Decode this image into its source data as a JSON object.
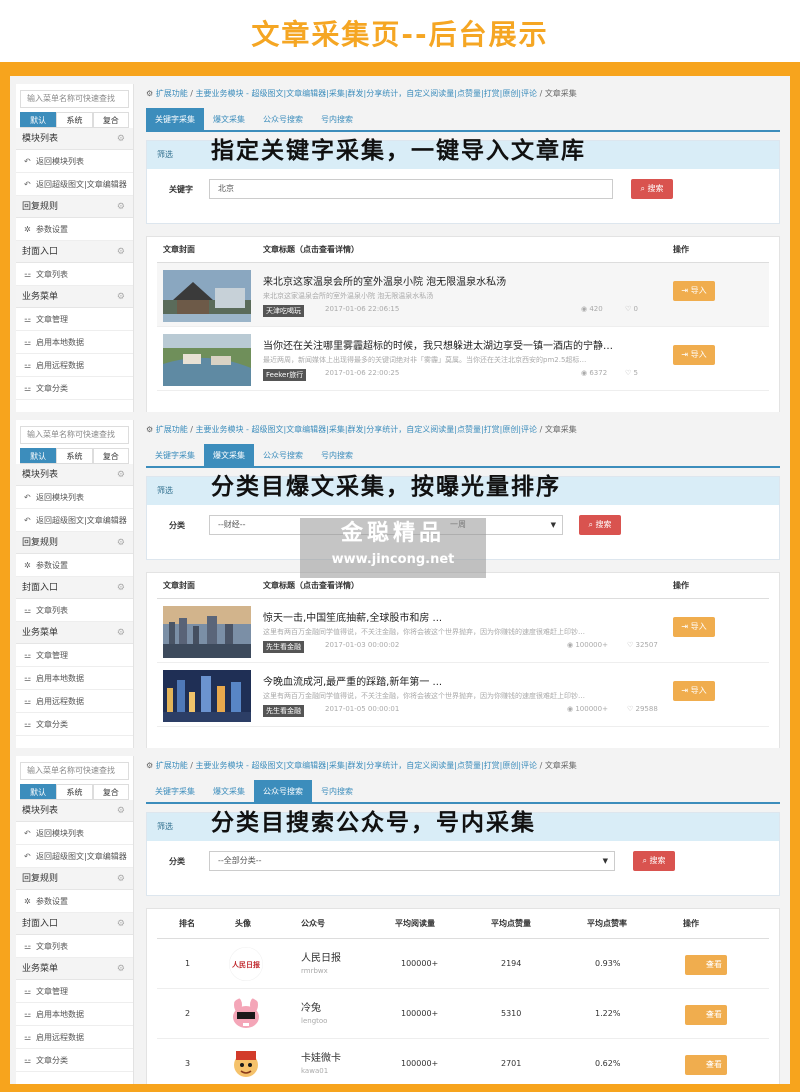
{
  "page_title": "文章采集页--后台展示",
  "sidebar": {
    "search_placeholder": "输入菜单名称可快速查找",
    "tabs": [
      "默认",
      "系统",
      "复合"
    ],
    "groups": [
      {
        "label": "模块列表",
        "items": [
          "返回模块列表",
          "返回超级图文|文章编辑器"
        ]
      },
      {
        "label": "回复规则",
        "items": [
          "参数设置"
        ]
      },
      {
        "label": "封面入口",
        "items": [
          "文章列表"
        ]
      },
      {
        "label": "业务菜单",
        "items": [
          "文章管理",
          "启用本地数据",
          "启用远程数据",
          "文章分类"
        ]
      }
    ]
  },
  "breadcrumb": {
    "root": "扩展功能",
    "module": "主要业务模块 - 超级图文|文章编辑器|采集|群发|分享统计，自定义阅读量|点赞量|打赏|原创|评论",
    "current": "文章采集"
  },
  "tabs": [
    "关键字采集",
    "爆文采集",
    "公众号搜索",
    "号内搜索"
  ],
  "filter_label": "筛选",
  "search_button": "搜索",
  "import_button": "导入",
  "view_button": "查看",
  "panel1": {
    "headline": "指定关键字采集，一键导入文章库",
    "field_label": "关键字",
    "field_value": "北京",
    "col_cover": "文章封面",
    "col_title": "文章标题（点击查看详情）",
    "col_action": "操作",
    "rows": [
      {
        "title": "来北京这家温泉会所的室外温泉小院 泡无限温泉水私汤",
        "desc": "来北京这家温泉会所的室外温泉小院 泡无限温泉水私汤",
        "source": "天津吃喝玩",
        "date": "2017-01-06 22:06:15",
        "views": "420",
        "likes": "0"
      },
      {
        "title": "当你还在关注哪里雾霾超标的时候，我只想躲进太湖边享受一镇一酒店的宁静…",
        "desc": "最近两周，新闻媒体上出现得最多的关键词绝对非「雾霾」莫属。当你还在关注北京西安的pm2.5超标…",
        "source": "Feeker旅行",
        "date": "2017-01-06 22:00:25",
        "views": "6372",
        "likes": "5"
      }
    ]
  },
  "panel2": {
    "headline": "分类目爆文采集，按曝光量排序",
    "field_label": "分类",
    "select_value": "--财经--",
    "select_value2": "一周",
    "col_cover": "文章封面",
    "col_title": "文章标题（点击查看详情）",
    "col_action": "操作",
    "rows": [
      {
        "title": "惊天一击,中国笙底抽薪,全球股市和房 ...",
        "desc": "这里有两百万金融同学值得说，不关注金融，你将会被这个世界抛弃，因为你赚钱的速度很难赶上印钞…",
        "source": "先生看金融",
        "date": "2017-01-03 00:00:02",
        "views": "100000+",
        "likes": "32507"
      },
      {
        "title": "今晚血流成河,最严重的踩踏,新年第一 ...",
        "desc": "这里有两百万金融同学值得说，不关注金融，你将会被这个世界抛弃，因为你赚钱的速度很难赶上印钞…",
        "source": "先生看金融",
        "date": "2017-01-05 00:00:01",
        "views": "100000+",
        "likes": "29588"
      }
    ]
  },
  "panel3": {
    "headline": "分类目搜索公众号，号内采集",
    "field_label": "分类",
    "select_value": "--全部分类--",
    "columns": [
      "排名",
      "头像",
      "公众号",
      "平均阅读量",
      "平均点赞量",
      "平均点赞率",
      "操作"
    ],
    "rows": [
      {
        "rank": "1",
        "name": "人民日报",
        "id": "rmrbwx",
        "reads": "100000+",
        "likes": "2194",
        "rate": "0.93%"
      },
      {
        "rank": "2",
        "name": "冷兔",
        "id": "lengtoo",
        "reads": "100000+",
        "likes": "5310",
        "rate": "1.22%"
      },
      {
        "rank": "3",
        "name": "卡娃微卡",
        "id": "kawa01",
        "reads": "100000+",
        "likes": "2701",
        "rate": "0.62%"
      }
    ],
    "avatar_logo_text": "人民日报"
  },
  "watermark": {
    "line1": "金聪精品",
    "line2": "www.jincong.net"
  },
  "colors": {
    "accent": "#3c8dbc",
    "orange": "#f7a41d",
    "danger": "#d9534f",
    "warning": "#f0ad4e",
    "title": "#f5a623"
  }
}
